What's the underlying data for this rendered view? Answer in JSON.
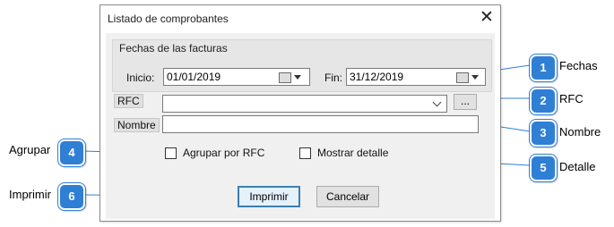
{
  "dialog": {
    "title": "Listado de comprobantes",
    "close_glyph": "✕",
    "dates_group_label": "Fechas de las facturas",
    "start_label": "Inicio:",
    "start_value": "01/01/2019",
    "end_label": "Fin:",
    "end_value": "31/12/2019",
    "rfc_label": "RFC",
    "rfc_value": "",
    "rfc_browse_label": "...",
    "name_label": "Nombre",
    "name_value": "",
    "group_by_rfc_label": "Agrupar por RFC",
    "group_by_rfc_checked": false,
    "show_detail_label": "Mostrar detalle",
    "show_detail_checked": false,
    "print_label": "Imprimir",
    "cancel_label": "Cancelar"
  },
  "callouts": [
    {
      "number": "1",
      "label": "Fechas"
    },
    {
      "number": "2",
      "label": "RFC"
    },
    {
      "number": "3",
      "label": "Nombre"
    },
    {
      "number": "4",
      "label": "Agrupar"
    },
    {
      "number": "5",
      "label": "Detalle"
    },
    {
      "number": "6",
      "label": "Imprimir"
    }
  ],
  "colors": {
    "callout": "#2f7fd4",
    "accent_button_border": "#3c7fb1"
  }
}
